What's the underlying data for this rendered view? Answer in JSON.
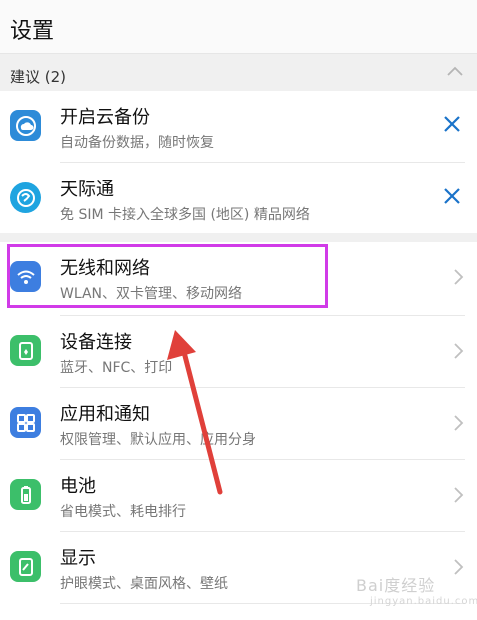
{
  "header": {
    "title": "设置"
  },
  "suggestions": {
    "label": "建议 (2)",
    "items": [
      {
        "title": "开启云备份",
        "subtitle": "自动备份数据，随时恢复",
        "icon": "cloud-backup-icon"
      },
      {
        "title": "天际通",
        "subtitle": "免 SIM 卡接入全球多国 (地区) 精品网络",
        "icon": "skytone-icon"
      }
    ]
  },
  "settings": {
    "items": [
      {
        "title": "无线和网络",
        "subtitle": "WLAN、双卡管理、移动网络",
        "icon": "wifi-icon"
      },
      {
        "title": "设备连接",
        "subtitle": "蓝牙、NFC、打印",
        "icon": "device-connection-icon"
      },
      {
        "title": "应用和通知",
        "subtitle": "权限管理、默认应用、应用分身",
        "icon": "apps-icon"
      },
      {
        "title": "电池",
        "subtitle": "省电模式、耗电排行",
        "icon": "battery-icon"
      },
      {
        "title": "显示",
        "subtitle": "护眼模式、桌面风格、壁纸",
        "icon": "display-icon"
      }
    ]
  },
  "watermark": {
    "text": "Bai度经验",
    "sub": "jingyan.baidu.com"
  },
  "colors": {
    "accent": "#1a73c9",
    "highlight": "#d13be8",
    "arrow": "#e0403a"
  }
}
